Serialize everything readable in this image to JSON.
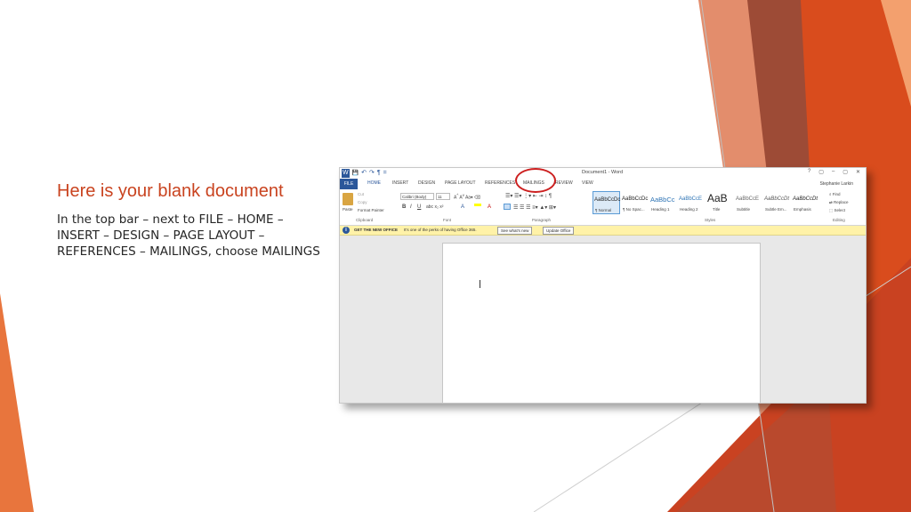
{
  "slide": {
    "title": "Here is your blank document",
    "body": "In the top bar – next to FILE – HOME – INSERT – DESIGN – PAGE LAYOUT – REFERENCES – MAILINGS, choose MAILINGS",
    "accent_color": "#c9431f"
  },
  "word": {
    "window_title": "Document1 - Word",
    "user": "Stephanie Larkin",
    "window_controls": [
      "?",
      "▢",
      "–",
      "▢",
      "✕"
    ],
    "tabs": [
      "FILE",
      "HOME",
      "INSERT",
      "DESIGN",
      "PAGE LAYOUT",
      "REFERENCES",
      "MAILINGS",
      "REVIEW",
      "VIEW"
    ],
    "clipboard": {
      "paste": "Paste",
      "cut": "Cut",
      "copy": "Copy",
      "format_painter": "Format Painter",
      "label": "Clipboard"
    },
    "font": {
      "name": "Calibri (Body)",
      "size": "11",
      "label": "Font"
    },
    "paragraph": {
      "label": "Paragraph"
    },
    "styles": {
      "label": "Styles",
      "items": [
        {
          "preview": "AaBbCcDc",
          "name": "¶ Normal"
        },
        {
          "preview": "AaBbCcDc",
          "name": "¶ No Spac..."
        },
        {
          "preview": "AaBbCc",
          "name": "Heading 1"
        },
        {
          "preview": "AaBbCcE",
          "name": "Heading 2"
        },
        {
          "preview": "AaB",
          "name": "Title"
        },
        {
          "preview": "AaBbCcE",
          "name": "Subtitle"
        },
        {
          "preview": "AaBbCcDt",
          "name": "Subtle Em..."
        },
        {
          "preview": "AaBbCcDt",
          "name": "Emphasis"
        }
      ]
    },
    "editing": {
      "find": "Find",
      "replace": "Replace",
      "select": "Select",
      "label": "Editing"
    },
    "infobar": {
      "title": "GET THE NEW OFFICE",
      "message": "It's one of the perks of having Office 365.",
      "see_whats_new": "See what's new",
      "update_office": "Update Office"
    },
    "cursor_glyph": "I",
    "qat": [
      "W",
      "💾",
      "↶",
      "↷",
      "¶",
      "="
    ]
  }
}
